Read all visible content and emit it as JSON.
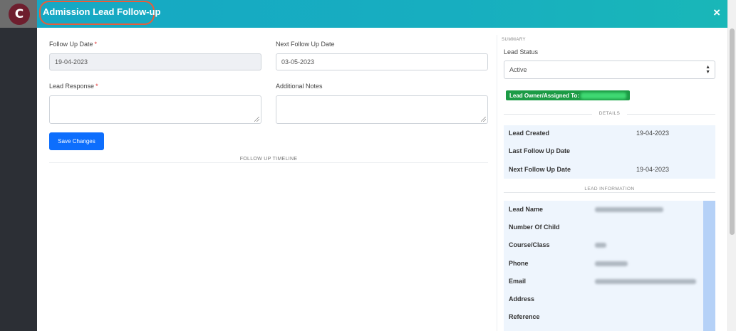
{
  "app": {
    "logo_letter": "C"
  },
  "modal": {
    "title": "Admission Lead Follow-up",
    "close_symbol": "×"
  },
  "form": {
    "follow_up_date": {
      "label": "Follow Up Date",
      "required": "*",
      "value": "19-04-2023"
    },
    "next_follow_up_date": {
      "label": "Next Follow Up Date",
      "value": "03-05-2023"
    },
    "lead_response": {
      "label": "Lead Response",
      "required": "*",
      "value": ""
    },
    "additional_notes": {
      "label": "Additional Notes",
      "value": ""
    },
    "save_label": "Save Changes",
    "timeline_heading": "FOLLOW UP TIMELINE"
  },
  "summary": {
    "heading": "SUMMARY",
    "lead_status_label": "Lead Status",
    "lead_status_value": "Active",
    "owner_label": "Lead Owner/Assigned To:",
    "details_heading": "DETAILS",
    "details": [
      {
        "label": "Lead Created",
        "value": "19-04-2023"
      },
      {
        "label": "Last Follow Up Date",
        "value": ""
      },
      {
        "label": "Next Follow Up Date",
        "value": "19-04-2023"
      }
    ],
    "lead_info_heading": "LEAD INFORMATION",
    "lead_info": [
      {
        "label": "Lead Name"
      },
      {
        "label": "Number Of Child"
      },
      {
        "label": "Course/Class"
      },
      {
        "label": "Phone"
      },
      {
        "label": "Email"
      },
      {
        "label": "Address"
      },
      {
        "label": "Reference"
      }
    ]
  },
  "colors": {
    "header_gradient_start": "#16a8c4",
    "header_gradient_end": "#19b7b8",
    "primary_button": "#0d6efd",
    "owner_badge": "#1c9b45",
    "highlight_outline": "#e85d3a",
    "sidebar": "#2c2f35"
  }
}
